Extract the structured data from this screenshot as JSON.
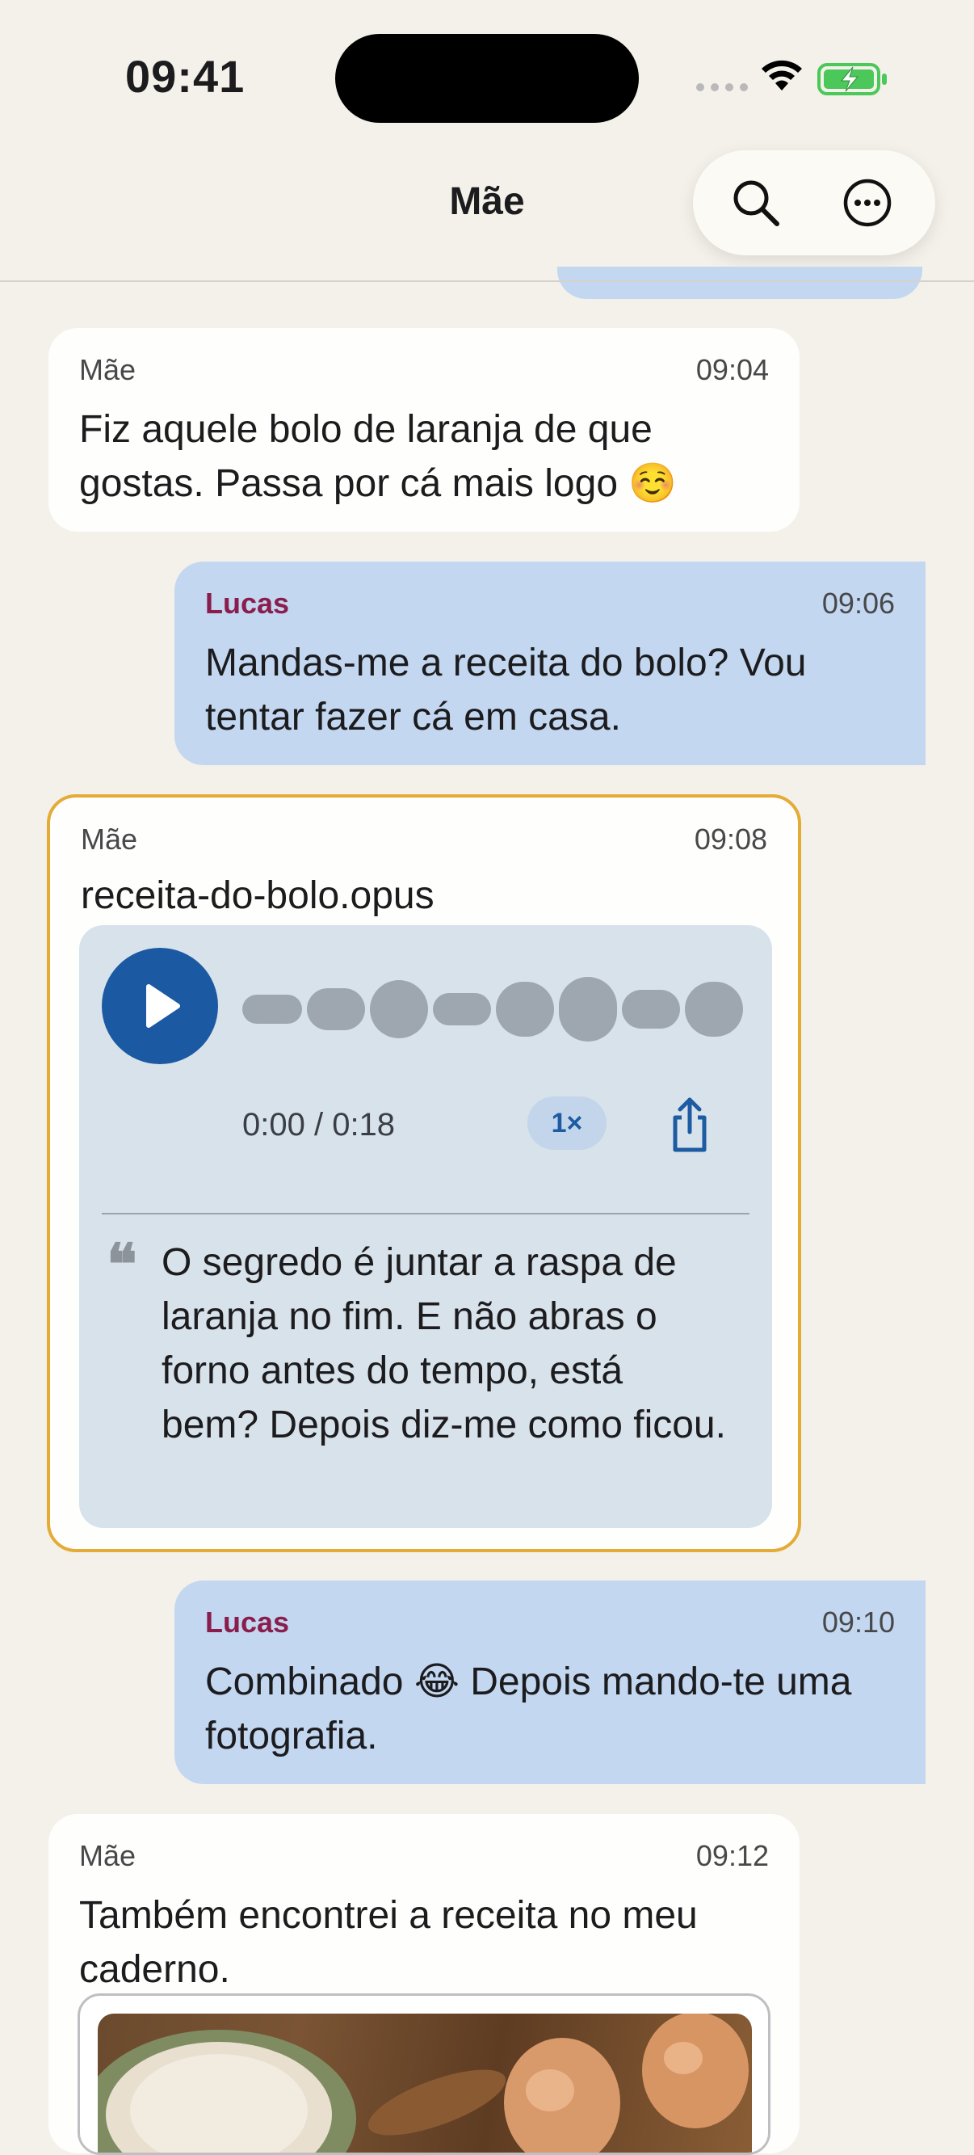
{
  "status_bar": {
    "time": "09:41"
  },
  "header": {
    "title": "Mãe"
  },
  "messages": [
    {
      "sender": "Mãe",
      "time": "09:04",
      "text": "Fiz aquele bolo de laranja de que gostas. Passa por cá mais logo ☺️"
    },
    {
      "sender": "Lucas",
      "time": "09:06",
      "text": "Mandas-me a receita do bolo? Vou tentar fazer cá em casa."
    },
    {
      "sender": "Mãe",
      "time": "09:08",
      "file_name": "receita-do-bolo.opus",
      "audio": {
        "time_label": "0:00 / 0:18",
        "speed": "1×",
        "progress": 0
      },
      "transcript": "O segredo é juntar a raspa de laranja no fim. E não abras o forno antes do tempo, está bem? Depois diz-me como ficou."
    },
    {
      "sender": "Lucas",
      "time": "09:10",
      "text": "Combinado 😂 Depois mando-te uma fotografia."
    },
    {
      "sender": "Mãe",
      "time": "09:12",
      "text": "Também encontrei a receita no meu caderno."
    }
  ],
  "colors": {
    "accent": "#1b5aa2",
    "highlight_border": "#e5ab37",
    "outgoing_bubble": "#c3d7f1",
    "sender_out": "#8a1d4b"
  }
}
